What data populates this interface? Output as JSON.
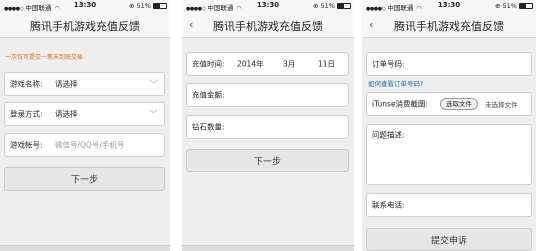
{
  "status_bar": {
    "carrier": "中国联通",
    "time": "13:30",
    "battery": "51%",
    "battery_level": 0.51
  },
  "nav_title": "腾讯手机游戏充值反馈",
  "screen1": {
    "notice": "一次仅可提交一笔未到账交易",
    "game_name_label": "游戏名称:",
    "game_name_value": "请选择",
    "login_label": "登录方式:",
    "login_value": "请选择",
    "account_label": "游戏帐号:",
    "account_placeholder": "微信号/QQ号/手机号",
    "next_button": "下一步"
  },
  "screen2": {
    "time_label": "充值时间:",
    "year": "2014年",
    "month": "3月",
    "day": "11日",
    "amount_label": "充值金额:",
    "diamonds_label": "钻石数量:",
    "next_button": "下一步"
  },
  "screen3": {
    "order_label": "订单号码:",
    "order_help_link": "如何查看订单号码?",
    "screenshot_label": "iTunse消费截图:",
    "choose_file_button": "选取文件",
    "no_file_text": "未选择文件",
    "description_label": "问题描述:",
    "phone_label": "联系电话:",
    "submit_button": "提交申诉"
  }
}
